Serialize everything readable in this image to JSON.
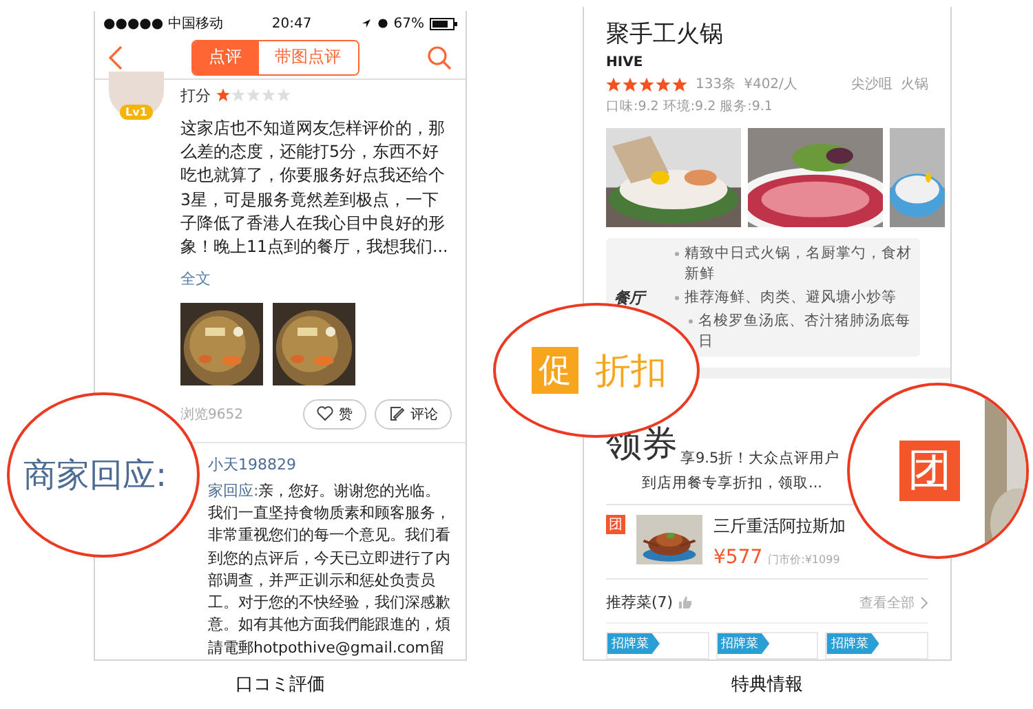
{
  "left_screen": {
    "status_bar": {
      "carrier": "●●●●● 中国移动",
      "time": "20:47",
      "battery": "67%"
    },
    "tabs": [
      {
        "label": "点评",
        "selected": true
      },
      {
        "label": "带图点评",
        "selected": false
      }
    ],
    "review": {
      "badge": "Lv1",
      "rating_label": "打分",
      "stars": 1,
      "text": "这家店也不知道网友怎样评价的，那么差的态度，还能打5分，东西不好吃也就算了，你要服务好点我还给个3星，可是服务竟然差到极点，一下子降低了香港人在我心目中良好的形象！晚上11点到的餐厅，我想我们...",
      "more_link": "全文",
      "views": "浏览9652",
      "actions": [
        {
          "kind": "like",
          "label": "赞"
        },
        {
          "kind": "comment",
          "label": "评论"
        }
      ]
    },
    "reply": {
      "author": "小天198829",
      "label": "家回应:",
      "text": "亲，您好。谢谢您的光临。我们一直坚持食物质素和顾客服务，非常重视您们的每一个意见。我们看到您的点评后，今天已立即进行了内部调查，并严正训示和惩处负责员工。对于您的不快经验，我们深感歉意。如有其他方面我們能跟進的，煩請電郵hotpothive@gmail.com留"
    },
    "magnifier": {
      "text": "商家回应:"
    },
    "caption": "口コミ評価"
  },
  "right_screen": {
    "shop": {
      "name": "聚手工火锅",
      "english_name": "HIVE",
      "stars": 5,
      "reviews": "133条",
      "price": "¥402/人",
      "location": "尖沙咀",
      "category": "火锅",
      "scores": "口味:9.2 环境:9.2 服务:9.1"
    },
    "info": {
      "label": "餐厅",
      "items": [
        "精致中日式火锅，名厨掌勺，食材新鲜",
        "推荐海鲜、肉类、避风塘小炒等",
        "名梭罗鱼汤底、杏汁猪肺汤底每日"
      ]
    },
    "promo_magnifier": {
      "badge": "促",
      "text": "折扣"
    },
    "coupon": {
      "title": "领券",
      "line_1": "享9.5折！大众点评用户",
      "line_2": "到店用餐专享折扣，领取..."
    },
    "deal": {
      "badge": "团",
      "title": "三斤重活阿拉斯加",
      "price": "¥577",
      "market_price": "门市价:¥1099"
    },
    "deal_magnifier": {
      "badge": "团"
    },
    "dishes": {
      "title": "推荐菜(7)",
      "link": "查看全部",
      "tags": [
        "招牌菜",
        "招牌菜",
        "招牌菜"
      ]
    },
    "caption": "特典情報"
  }
}
